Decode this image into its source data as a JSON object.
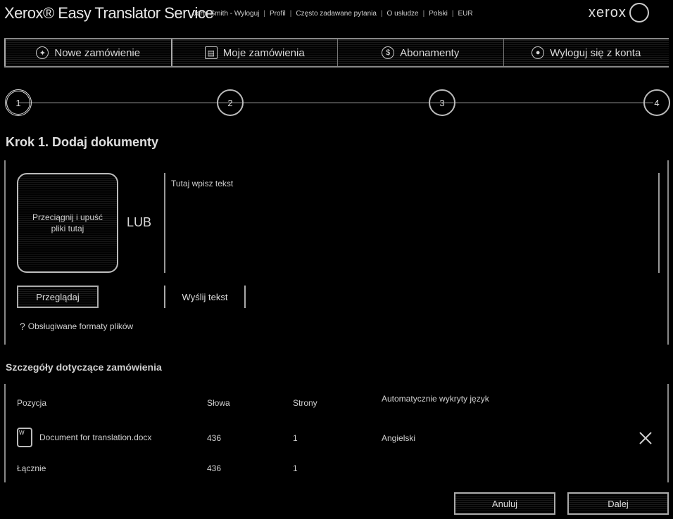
{
  "header": {
    "app_title": "Xerox® Easy Translator Service",
    "nav": [
      "John Smith - Wyloguj",
      "Profil",
      "Często zadawane pytania",
      "O usłudze",
      "Polski",
      "EUR"
    ],
    "brand": "xerox"
  },
  "tabs": [
    {
      "label": "Nowe zamówienie",
      "icon": "sparkle-icon"
    },
    {
      "label": "Moje zamówienia",
      "icon": "clipboard-icon"
    },
    {
      "label": "Abonamenty",
      "icon": "dollar-icon"
    },
    {
      "label": "Wyloguj się z konta",
      "icon": "user-icon"
    }
  ],
  "steps": [
    "1",
    "2",
    "3",
    "4"
  ],
  "step_title": "Krok 1. Dodaj dokumenty",
  "upload": {
    "dropzone_label": "Przeciągnij i upuść pliki tutaj",
    "or_label": "LUB",
    "text_placeholder": "Tutaj wpisz tekst",
    "browse_button": "Przeglądaj",
    "send_text_button": "Wyślij tekst",
    "help_link": "Obsługiwane formaty plików"
  },
  "order": {
    "title": "Szczegóły dotyczące zamówienia",
    "columns": [
      "Pozycja",
      "Słowa",
      "Strony",
      "Automatycznie wykryty język"
    ],
    "rows": [
      {
        "item": "Document for translation.docx",
        "words": "436",
        "pages": "1",
        "language": "Angielski"
      }
    ],
    "total": {
      "label": "Łącznie",
      "words": "436",
      "pages": "1"
    }
  },
  "footer": {
    "cancel_button": "Anuluj",
    "next_button": "Dalej"
  }
}
